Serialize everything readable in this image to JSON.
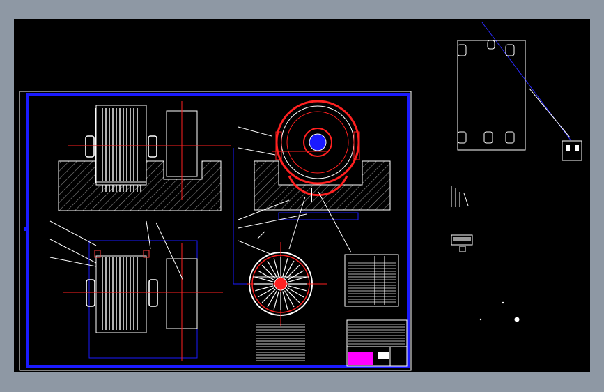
{
  "app": {
    "window_background": "#8e98a4",
    "canvas_background": "#000000"
  },
  "drawing": {
    "colors": {
      "border": "#1a1aff",
      "red": "#ff2020",
      "white": "#ffffff",
      "hatch": "#9a9a9a",
      "magenta": "#ff00ff"
    }
  },
  "icons": [
    "ucs-icon",
    "cursor-crosshair-icon"
  ]
}
